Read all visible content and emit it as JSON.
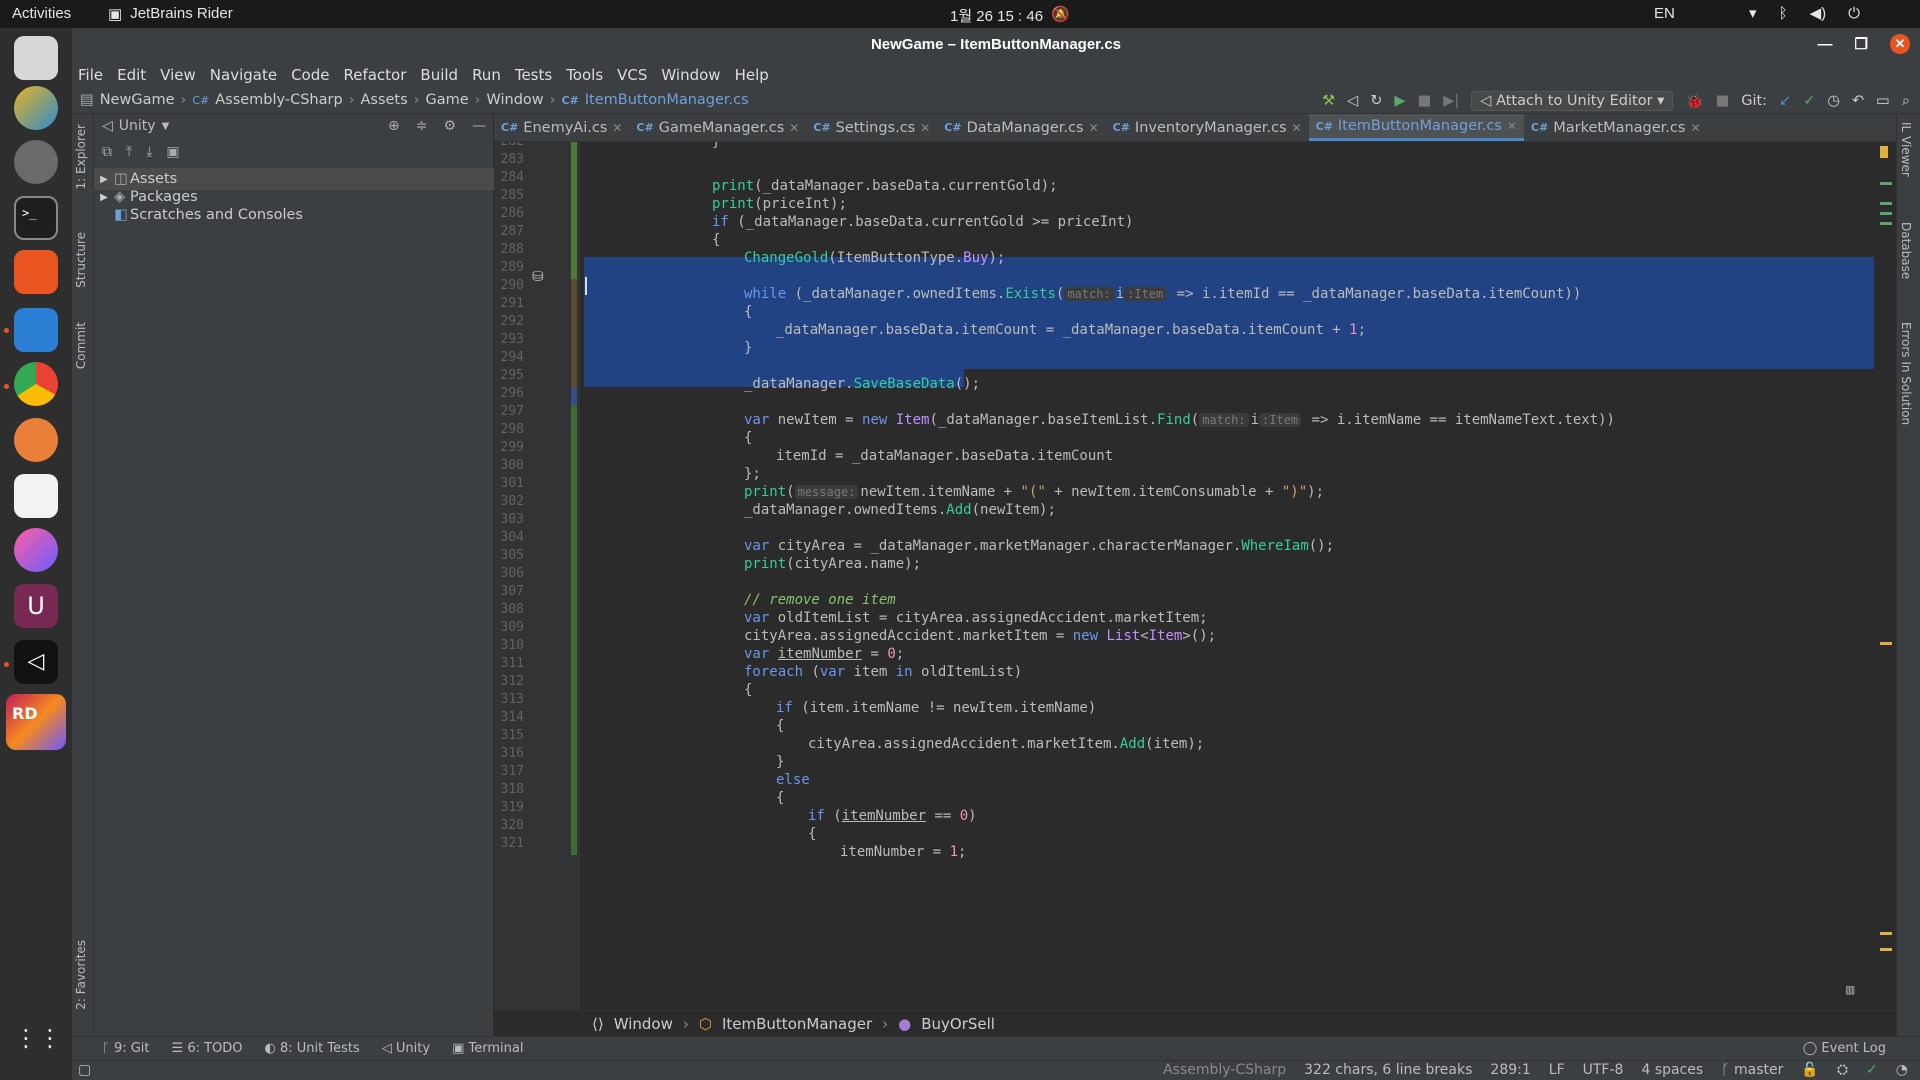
{
  "topbar": {
    "activities": "Activities",
    "app_name": "JetBrains Rider",
    "clock": "1월 26 15 : 46",
    "lang": "EN"
  },
  "window": {
    "title": "NewGame – ItemButtonManager.cs"
  },
  "menu": [
    "File",
    "Edit",
    "View",
    "Navigate",
    "Code",
    "Refactor",
    "Build",
    "Run",
    "Tests",
    "Tools",
    "VCS",
    "Window",
    "Help"
  ],
  "nav": {
    "crumbs": [
      "NewGame",
      "Assembly-CSharp",
      "Assets",
      "Game",
      "Window",
      "ItemButtonManager.cs"
    ],
    "run_config": "Attach to Unity Editor",
    "git_label": "Git:"
  },
  "left_tabs": [
    "1: Explorer",
    "Structure",
    "Commit",
    "2: Favorites"
  ],
  "right_tabs": [
    "IL Viewer",
    "Database",
    "Errors In Solution"
  ],
  "project": {
    "view": "Unity",
    "tree": [
      "Assets",
      "Packages",
      "Scratches and Consoles"
    ]
  },
  "tabs": [
    {
      "name": "EnemyAi.cs",
      "active": false
    },
    {
      "name": "GameManager.cs",
      "active": false
    },
    {
      "name": "Settings.cs",
      "active": false
    },
    {
      "name": "DataManager.cs",
      "active": false
    },
    {
      "name": "InventoryManager.cs",
      "active": false
    },
    {
      "name": "ItemButtonManager.cs",
      "active": true
    },
    {
      "name": "MarketManager.cs",
      "active": false
    }
  ],
  "code": {
    "lines": [
      282,
      283,
      284,
      285,
      286,
      287,
      288,
      289,
      290,
      291,
      292,
      293,
      294,
      295,
      296,
      297,
      298,
      299,
      300,
      301,
      302,
      303,
      304,
      305,
      306,
      307,
      308,
      309,
      310,
      311,
      312,
      313,
      314,
      315,
      316,
      317,
      318,
      319,
      320,
      321
    ],
    "text": {
      "l282": "}",
      "l284a": "print",
      "l284b": "(_dataManager.baseData.currentGold);",
      "l285a": "print",
      "l285b": "(priceInt);",
      "l286a": "if",
      "l286b": " (_dataManager.baseData.currentGold >= priceInt)",
      "l287": "{",
      "l288a": "ChangeGold",
      "l288b": "(ItemButtonType.",
      "l288c": "Buy",
      "l288d": ");",
      "l290a": "while",
      "l290b": " (_dataManager.ownedItems.",
      "l290c": "Exists",
      "l290d": "(",
      "l290h1": "match:",
      "l290e": "i",
      "l290h2": ":Item",
      "l290f": " => i.itemId == _dataManager.baseData.itemCount))",
      "l291": "{",
      "l292a": "_dataManager.baseData.itemCount = _dataManager.baseData.itemCount + ",
      "l292b": "1",
      "l292c": ";",
      "l293": "}",
      "l295a": "_dataManager.",
      "l295b": "SaveBaseData",
      "l295c": "();",
      "l297a": "var",
      "l297b": " newItem = ",
      "l297c": "new",
      "l297d": " ",
      "l297e": "Item",
      "l297f": "(_dataManager.baseItemList.",
      "l297g": "Find",
      "l297h": "(",
      "l297h1": "match:",
      "l297i": "i",
      "l297h2": ":Item",
      "l297j": " => i.itemName == itemNameText.text))",
      "l298": "{",
      "l299": "itemId = _dataManager.baseData.itemCount",
      "l300": "};",
      "l301a": "print",
      "l301b": "(",
      "l301h": "message:",
      "l301c": "newItem.itemName + ",
      "l301d": "\"(\"",
      "l301e": " + newItem.itemConsumable + ",
      "l301f": "\")\"",
      "l301g": ");",
      "l302a": "_dataManager.ownedItems.",
      "l302b": "Add",
      "l302c": "(newItem);",
      "l304a": "var",
      "l304b": " cityArea = _dataManager.marketManager.characterManager.",
      "l304c": "WhereIam",
      "l304d": "();",
      "l305a": "print",
      "l305b": "(cityArea.name);",
      "l307": "// remove one item",
      "l308a": "var",
      "l308b": " oldItemList = cityArea.assignedAccident.marketItem;",
      "l309a": "cityArea.assignedAccident.marketItem = ",
      "l309b": "new",
      "l309c": " ",
      "l309d": "List",
      "l309e": "<",
      "l309f": "Item",
      "l309g": ">();",
      "l310a": "var",
      "l310b": " ",
      "l310c": "itemNumber",
      "l310d": " = ",
      "l310e": "0",
      "l310f": ";",
      "l311a": "foreach",
      "l311b": " (",
      "l311c": "var",
      "l311d": " item ",
      "l311e": "in",
      "l311f": " oldItemList)",
      "l312": "{",
      "l313a": "if",
      "l313b": " (item.itemName != newItem.itemName)",
      "l314": "{",
      "l315a": "cityArea.assignedAccident.marketItem.",
      "l315b": "Add",
      "l315c": "(item);",
      "l316": "}",
      "l317": "else",
      "l318": "{",
      "l319a": "if",
      "l319b": " (",
      "l319c": "itemNumber",
      "l319d": " == ",
      "l319e": "0",
      "l319f": ")",
      "l320": "{",
      "l321a": "itemNumber = ",
      "l321b": "1",
      "l321c": ";"
    }
  },
  "editor_breadcrumb": [
    "Window",
    "ItemButtonManager",
    "BuyOrSell"
  ],
  "bottom_tools": [
    "9: Git",
    "6: TODO",
    "8: Unit Tests",
    "Unity",
    "Terminal"
  ],
  "event_log": "Event Log",
  "status": {
    "project": "Assembly-CSharp",
    "selection": "322 chars, 6 line breaks",
    "position": "289:1",
    "line_sep": "LF",
    "encoding": "UTF-8",
    "indent": "4 spaces",
    "branch": "master"
  }
}
